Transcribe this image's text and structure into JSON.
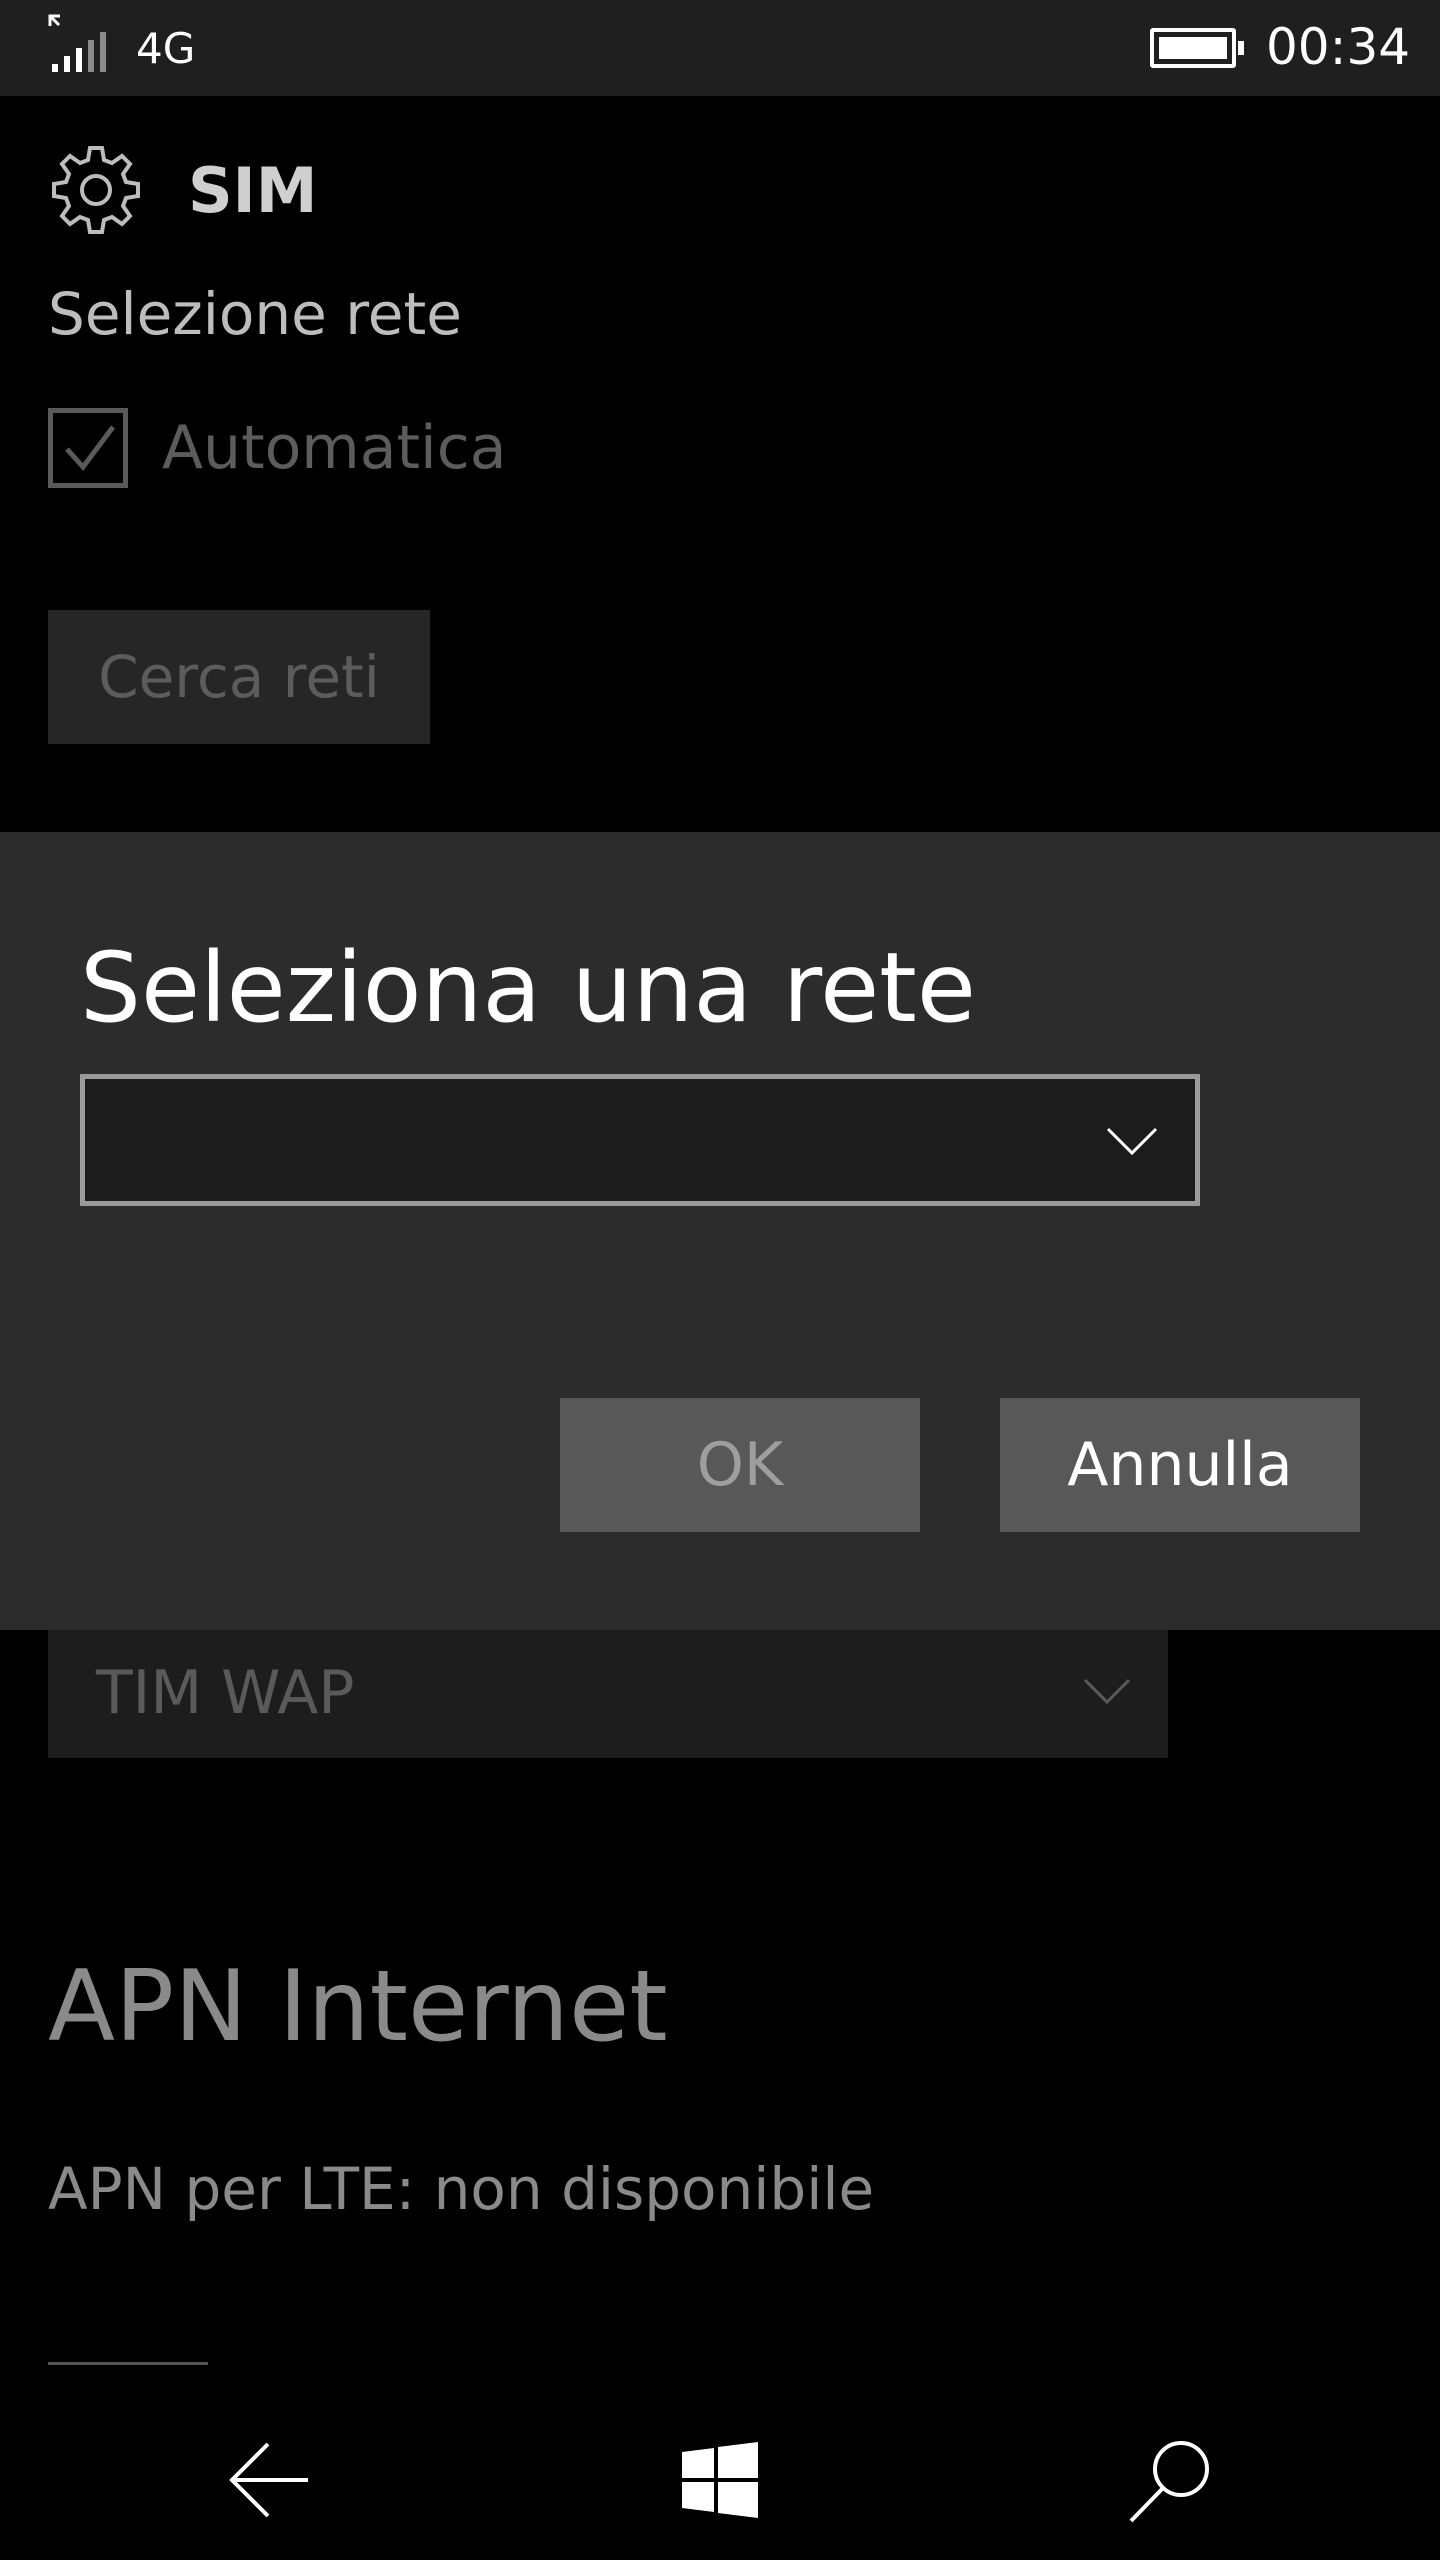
{
  "status_bar": {
    "network_type": "4G",
    "time": "00:34",
    "icons": [
      "signal-icon",
      "battery-icon"
    ]
  },
  "page": {
    "title": "SIM",
    "section_label": "Selezione rete",
    "automatic_checkbox": {
      "label": "Automatica",
      "checked": true,
      "enabled": false
    },
    "search_button_label": "Cerca reti",
    "apn_select_value": "TIM WAP",
    "apn_heading": "APN Internet",
    "apn_lte_note": "APN per LTE: non disponibile"
  },
  "dialog": {
    "title": "Seleziona una rete",
    "combo_value": "",
    "ok_label": "OK",
    "cancel_label": "Annulla"
  },
  "nav_bar": {
    "icons": [
      "back-arrow-icon",
      "windows-logo-icon",
      "search-icon"
    ]
  },
  "colors": {
    "status_bar_bg": "#1f1f1f",
    "dialog_bg": "#2c2c2c",
    "button_bg": "#585858",
    "page_bg": "#000000"
  }
}
